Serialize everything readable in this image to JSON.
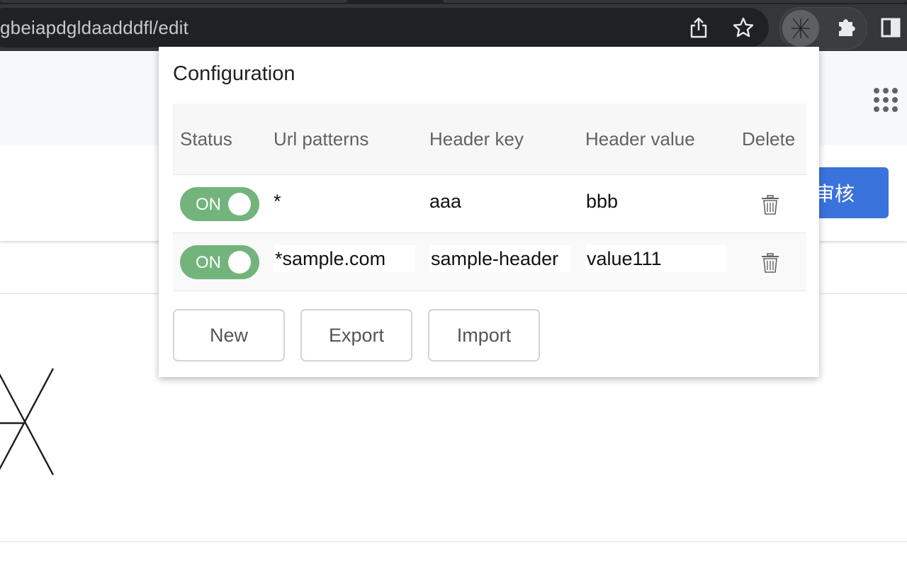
{
  "browser": {
    "url_fragment": "gbeiapdgldaadddfl/edit",
    "icons": [
      "share-icon",
      "star-icon",
      "extension-avatar-icon",
      "puzzle-icon",
      "side-panel-icon"
    ]
  },
  "page": {
    "review_button": "审核",
    "icons": [
      "apps-grid-icon"
    ]
  },
  "popup": {
    "title": "Configuration",
    "columns": [
      "Status",
      "Url patterns",
      "Header key",
      "Header value",
      "Delete"
    ],
    "rows": [
      {
        "status": "ON",
        "url_pattern": "*",
        "header_key": "aaa",
        "header_value": "bbb"
      },
      {
        "status": "ON",
        "url_pattern": "*sample.com",
        "header_key": "sample-header",
        "header_value": "value111"
      }
    ],
    "buttons": {
      "new": "New",
      "export": "Export",
      "import": "Import"
    }
  },
  "colors": {
    "toggle_on": "#73b47d",
    "primary_button": "#3b73dd",
    "toolbar": "#35363a"
  }
}
